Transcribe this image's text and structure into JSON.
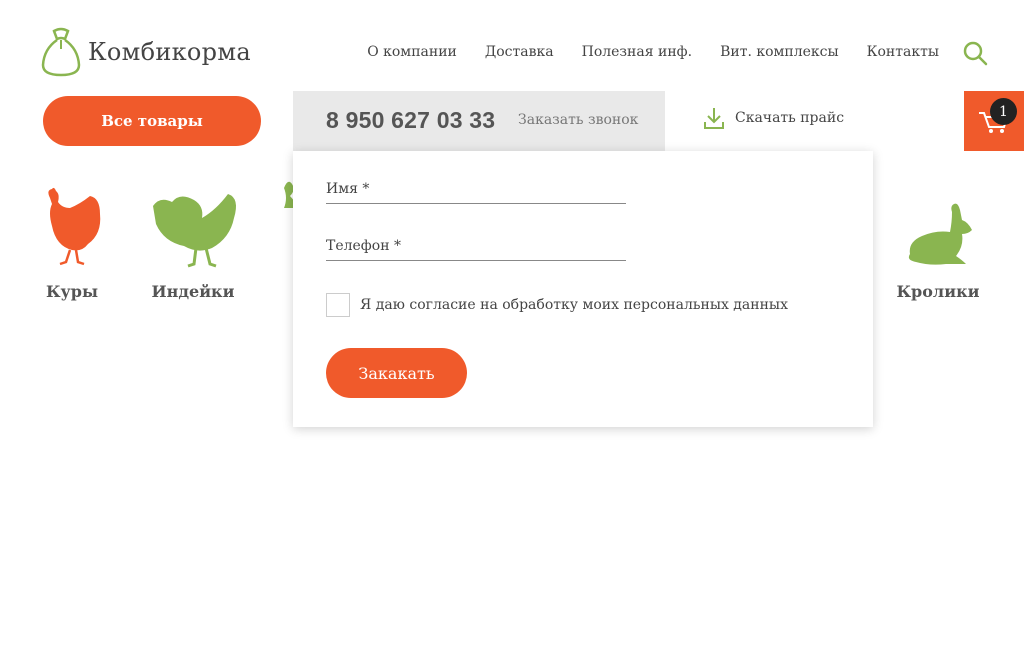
{
  "header": {
    "logo_text": "Комбикорма",
    "nav": [
      {
        "label": "О компании"
      },
      {
        "label": "Доставка"
      },
      {
        "label": "Полезная инф."
      },
      {
        "label": "Вит. комплексы"
      },
      {
        "label": "Контакты"
      }
    ],
    "search_icon": "search-icon"
  },
  "toolbar": {
    "all_goods_label": "Все товары",
    "phone": "8 950 627 03 33",
    "callback_label": "Заказать звонок",
    "download_label": "Скачать прайс",
    "cart_count": "1"
  },
  "animals": [
    {
      "label": "Куры",
      "icon": "chicken-icon",
      "color": "#f05a2b"
    },
    {
      "label": "Индейки",
      "icon": "turkey-icon",
      "color": "#8ab550"
    },
    {
      "label": "Кролики",
      "icon": "rabbit-icon",
      "color": "#8ab550"
    }
  ],
  "popup": {
    "name_label": "Имя *",
    "phone_label": "Телефон *",
    "consent_text": "Я даю согласие на обработку моих персональных данных",
    "submit_label": "Закакать"
  },
  "colors": {
    "accent": "#f05a2b",
    "green": "#8ab550",
    "gray_box": "#e9e9e9"
  }
}
